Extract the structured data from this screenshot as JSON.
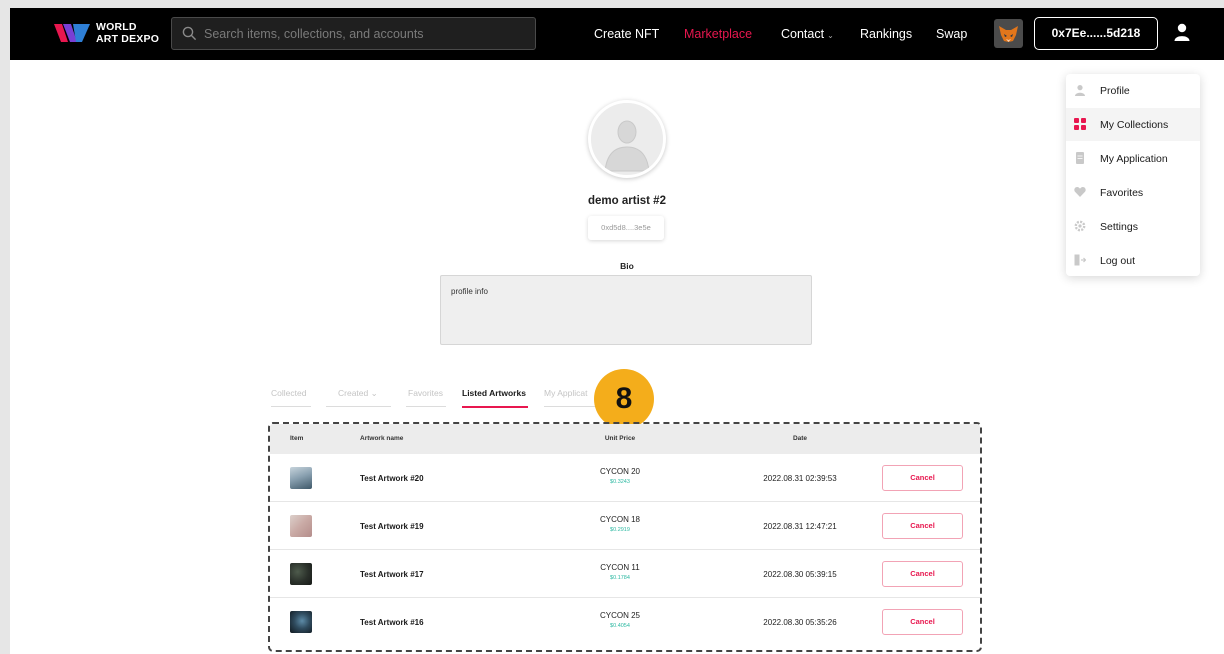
{
  "nav": {
    "logo_line1": "WORLD",
    "logo_line2": "ART DEXPO",
    "search_placeholder": "Search items, collections, and accounts",
    "menu": {
      "create": "Create NFT",
      "marketplace": "Marketplace",
      "contact": "Contact",
      "rankings": "Rankings",
      "swap": "Swap"
    },
    "wallet": "0x7Ee......5d218",
    "accent": "#e8174f"
  },
  "profile": {
    "name": "demo artist #2",
    "address": "0xd5d8....3e5e",
    "bio_label": "Bio",
    "bio_text": "profile info"
  },
  "tabs": [
    "Collected",
    "Created",
    "Favorites",
    "Listed Artworks",
    "My Applicat"
  ],
  "active_tab": "Listed Artworks",
  "annotation_badge": "8",
  "table": {
    "headers": {
      "item": "Item",
      "name": "Artwork name",
      "price": "Unit Price",
      "date": "Date"
    },
    "rows": [
      {
        "name": "Test Artwork #20",
        "price": "CYCON 20",
        "usd": "$0.3243",
        "date": "2022.08.31 02:39:53",
        "action": "Cancel"
      },
      {
        "name": "Test Artwork #19",
        "price": "CYCON 18",
        "usd": "$0.2919",
        "date": "2022.08.31 12:47:21",
        "action": "Cancel"
      },
      {
        "name": "Test Artwork #17",
        "price": "CYCON 11",
        "usd": "$0.1784",
        "date": "2022.08.30 05:39:15",
        "action": "Cancel"
      },
      {
        "name": "Test Artwork #16",
        "price": "CYCON 25",
        "usd": "$0.4054",
        "date": "2022.08.30 05:35:26",
        "action": "Cancel"
      }
    ]
  },
  "dropdown": {
    "items": [
      {
        "label": "Profile",
        "icon": "user-icon"
      },
      {
        "label": "My Collections",
        "icon": "grid-icon"
      },
      {
        "label": "My Application",
        "icon": "document-icon"
      },
      {
        "label": "Favorites",
        "icon": "heart-icon"
      },
      {
        "label": "Settings",
        "icon": "gear-icon"
      },
      {
        "label": "Log out",
        "icon": "logout-icon"
      }
    ],
    "highlighted": "My Collections"
  }
}
